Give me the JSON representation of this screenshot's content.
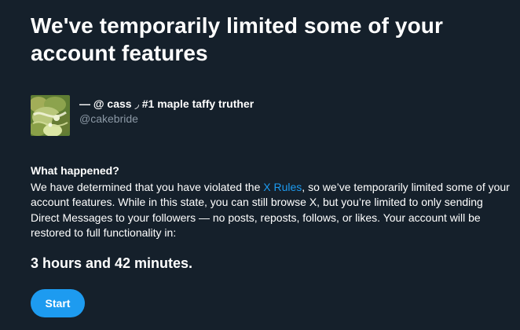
{
  "colors": {
    "background": "#15202b",
    "text": "#ffffff",
    "muted": "#8b98a5",
    "accent": "#1d9bf0"
  },
  "headline": "We've temporarily limited some of your account features",
  "account": {
    "display_name": "— @ cass ◞ #1 maple taffy truther",
    "handle": "@cakebride",
    "avatar_icon": "profile-photo-avatar-icon"
  },
  "what_happened": {
    "title": "What happened?",
    "body_before_link": "We have determined that you have violated the ",
    "link_label": "X Rules",
    "body_after_link": ", so we’ve temporarily limited some of your account features. While in this state, you can still browse X, but you’re limited to only sending Direct Messages to your followers — no posts, reposts, follows, or likes. Your account will be restored to full functionality in:"
  },
  "countdown": "3 hours and 42 minutes.",
  "start_button_label": "Start"
}
